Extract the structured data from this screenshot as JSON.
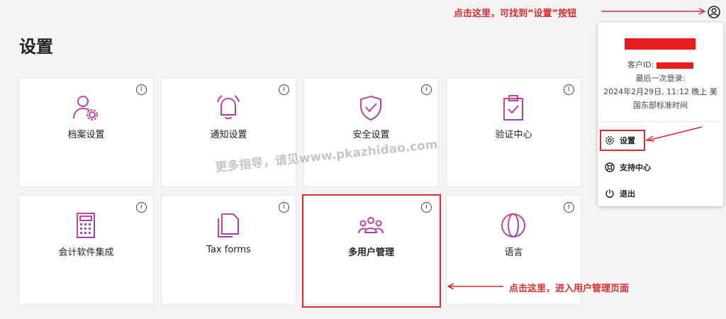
{
  "page": {
    "title": "设置"
  },
  "cards": [
    {
      "label": "档案设置",
      "icon": "profile-settings-icon"
    },
    {
      "label": "通知设置",
      "icon": "bell-icon"
    },
    {
      "label": "安全设置",
      "icon": "shield-check-icon"
    },
    {
      "label": "验证中心",
      "icon": "clipboard-check-icon"
    },
    {
      "label": "会计软件集成",
      "icon": "calculator-icon"
    },
    {
      "label": "Tax forms",
      "icon": "documents-icon"
    },
    {
      "label": "多用户管理",
      "icon": "users-icon"
    },
    {
      "label": "语言",
      "icon": "globe-icon"
    }
  ],
  "info_glyph": "i",
  "dropdown": {
    "customer_id_label": "客户ID: ",
    "last_login_line1": "最后一次登录:",
    "last_login_line2": "2024年2月29日, 11:12 晚上 美",
    "last_login_line3": "国东部标准时间",
    "items": [
      {
        "label": "设置",
        "icon": "gear-icon"
      },
      {
        "label": "支持中心",
        "icon": "lifebuoy-icon"
      },
      {
        "label": "退出",
        "icon": "power-icon"
      }
    ]
  },
  "annotations": {
    "top": "点击这里，可找到“设置”按钮",
    "bottom": "点击这里，进入用户管理页面"
  },
  "watermark": "更多指导，请见www.pkazhidao.com",
  "colors": {
    "accent_red": "#d92b2b",
    "icon_gradient_start": "#e0457b",
    "icon_gradient_end": "#8b3fc6"
  }
}
